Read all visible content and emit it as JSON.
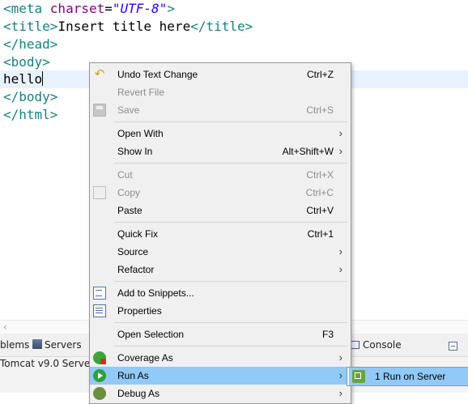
{
  "editor": {
    "lines": [
      {
        "open": "<meta ",
        "attr": "charset",
        "eq": "=",
        "str": "\"UTF-8\"",
        "close": ">"
      },
      {
        "tag1": "<title>",
        "text": "Insert title here",
        "tag2": "</title>"
      },
      {
        "tag": "</head>"
      },
      {
        "tag": "<body>"
      },
      {
        "text": "hello"
      },
      {
        "tag": "</body>"
      },
      {
        "tag": "</html>"
      }
    ]
  },
  "bottom_panel": {
    "tabs": {
      "problems": "blems",
      "servers": "Servers",
      "console": "Console"
    },
    "server_row": "Tomcat v9.0 Server a"
  },
  "context_menu": {
    "items": [
      {
        "label": "Undo Text Change",
        "accel": "Ctrl+Z",
        "icon": "undo-icon"
      },
      {
        "label": "Revert File",
        "accel": "",
        "disabled": true
      },
      {
        "label": "Save",
        "accel": "Ctrl+S",
        "disabled": true,
        "icon": "save-icon"
      },
      {
        "label": "Open With",
        "submenu": true
      },
      {
        "label": "Show In",
        "accel": "Alt+Shift+W",
        "submenu": true
      },
      {
        "label": "Cut",
        "accel": "Ctrl+X",
        "disabled": true
      },
      {
        "label": "Copy",
        "accel": "Ctrl+C",
        "disabled": true,
        "icon": "copy-icon"
      },
      {
        "label": "Paste",
        "accel": "Ctrl+V"
      },
      {
        "label": "Quick Fix",
        "accel": "Ctrl+1"
      },
      {
        "label": "Source",
        "submenu": true
      },
      {
        "label": "Refactor",
        "submenu": true
      },
      {
        "label": "Add to Snippets...",
        "icon": "snippet-icon"
      },
      {
        "label": "Properties",
        "icon": "properties-icon"
      },
      {
        "label": "Open Selection",
        "accel": "F3"
      },
      {
        "label": "Coverage As",
        "submenu": true,
        "icon": "coverage-icon"
      },
      {
        "label": "Run As",
        "submenu": true,
        "highlighted": true,
        "icon": "run-icon"
      },
      {
        "label": "Debug As",
        "submenu": true,
        "icon": "debug-icon"
      }
    ]
  },
  "run_as_submenu": {
    "items": [
      {
        "label": "1 Run on Server",
        "icon": "server-run-icon",
        "highlighted": true
      }
    ]
  },
  "colors": {
    "highlight": "#91c9f7",
    "tag": "#17807e",
    "attribute": "#7f007f",
    "string": "#2a00ff",
    "current_line": "#e8f2fe"
  }
}
